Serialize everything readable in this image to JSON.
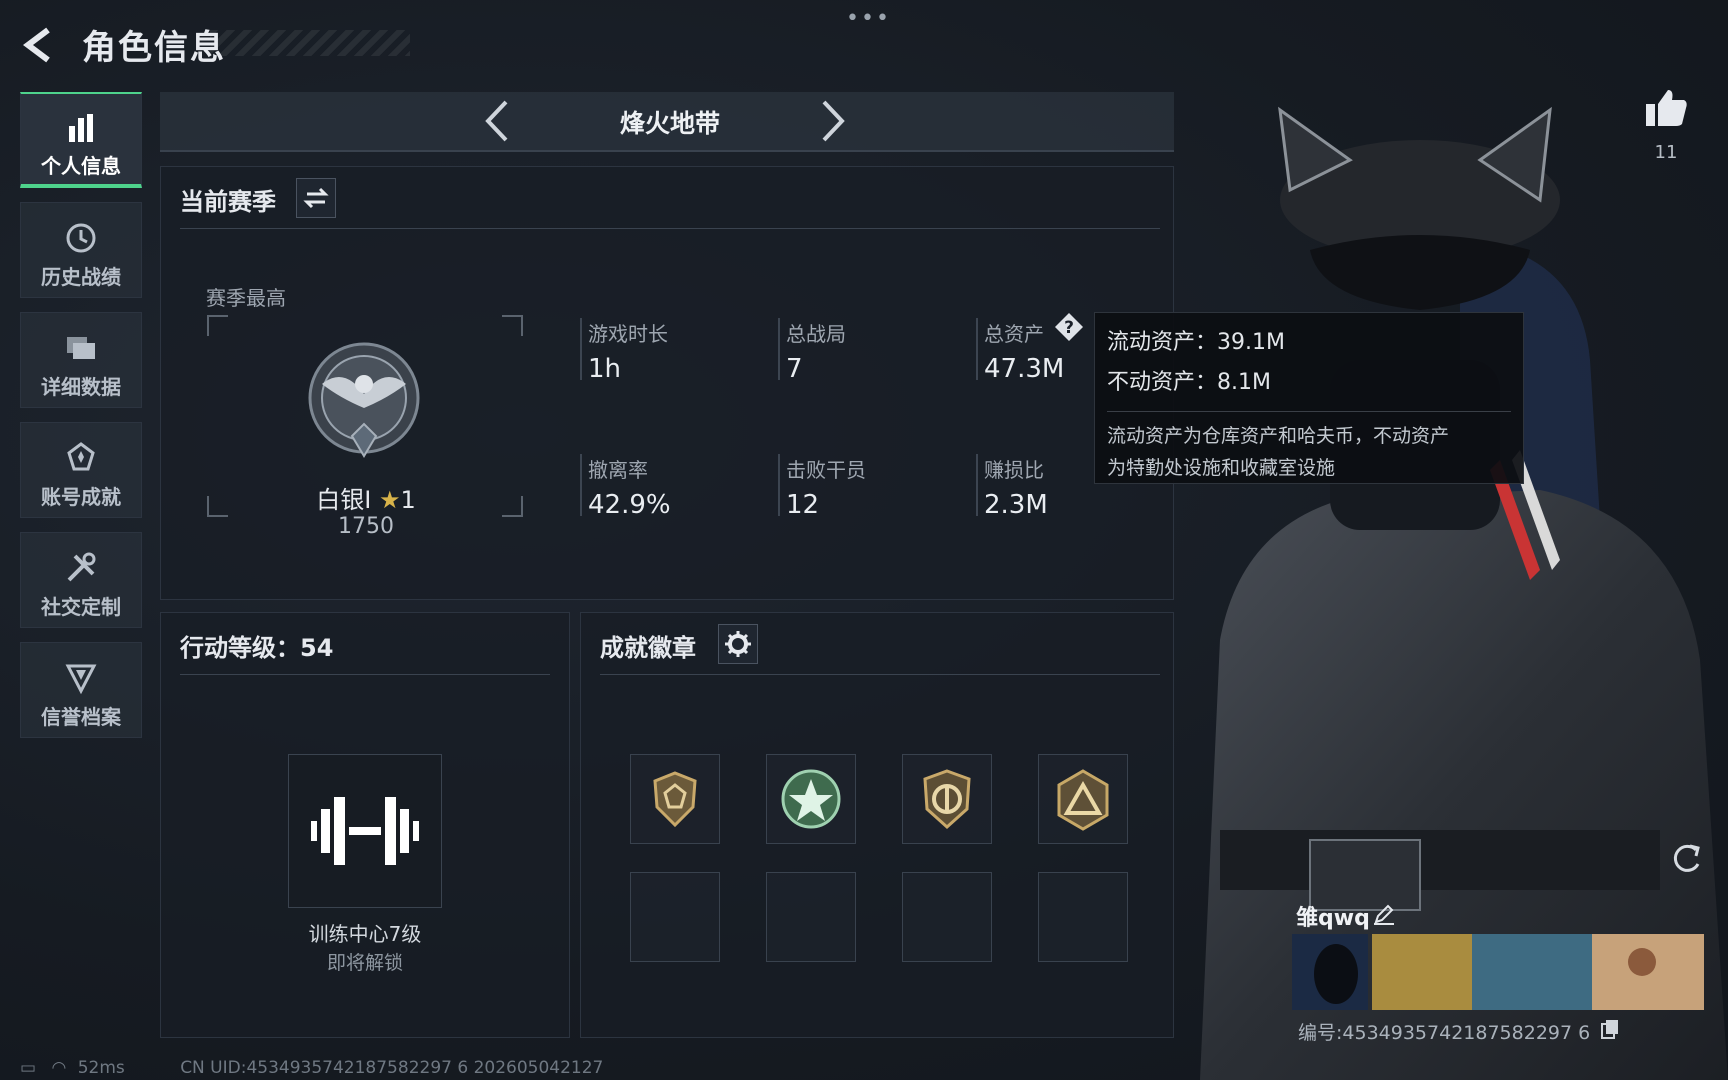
{
  "header": {
    "title": "角色信息"
  },
  "sidebar": {
    "items": [
      {
        "label": "个人信息",
        "icon": "bar-chart-icon",
        "active": true
      },
      {
        "label": "历史战绩",
        "icon": "history-icon"
      },
      {
        "label": "详细数据",
        "icon": "folder-icon"
      },
      {
        "label": "账号成就",
        "icon": "achievement-icon"
      },
      {
        "label": "社交定制",
        "icon": "tools-icon"
      },
      {
        "label": "信誉档案",
        "icon": "shield-icon"
      }
    ]
  },
  "mode": {
    "title": "烽火地带"
  },
  "season": {
    "header": "当前赛季",
    "best_label": "赛季最高",
    "rank_name": "白银I",
    "rank_stars": "1",
    "rank_score": "1750",
    "stats": [
      {
        "label": "游戏时长",
        "value": "1h"
      },
      {
        "label": "总战局",
        "value": "7"
      },
      {
        "label": "总资产",
        "value": "47.3M"
      },
      {
        "label": "撤离率",
        "value": "42.9%"
      },
      {
        "label": "击败干员",
        "value": "12"
      },
      {
        "label": "赚损比",
        "value": "2.3M"
      }
    ]
  },
  "tooltip": {
    "line1": "流动资产：39.1M",
    "line2": "不动资产：8.1M",
    "desc1": "流动资产为仓库资产和哈夫币，不动资产",
    "desc2": "为特勤处设施和收藏室设施"
  },
  "action_level": {
    "header": "行动等级：54",
    "unlock_title": "训练中心7级",
    "unlock_status": "即将解锁"
  },
  "medals": {
    "header": "成就徽章"
  },
  "profile": {
    "like_count": "11",
    "name": "雏qwq",
    "id_label": "编号:4534935742187582297 6"
  },
  "status": {
    "ping": "52ms",
    "uid": "CN UID:4534935742187582297 6 202605042127"
  },
  "colors": {
    "accent": "#4ed38c",
    "bg": "#161b22",
    "panel": "#1a2029"
  }
}
